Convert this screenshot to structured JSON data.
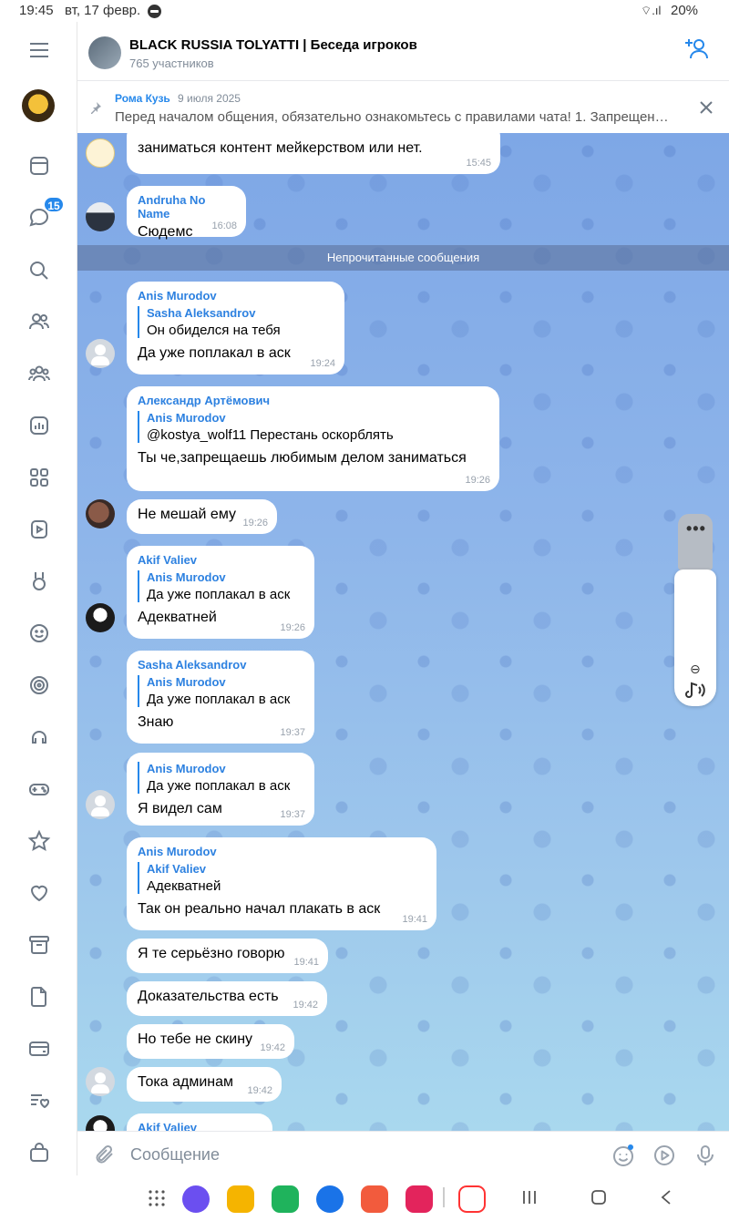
{
  "status": {
    "time": "19:45",
    "date": "вт, 17 февр.",
    "battery": "20%"
  },
  "nav": {
    "badge": "15"
  },
  "header": {
    "title": "BLACK RUSSIA TOLYATTI | Беседа игроков",
    "subtitle": "765 участников"
  },
  "pinned": {
    "author": "Рома Кузь",
    "date": "9 июля 2025",
    "text": "Перед началом общения, обязательно ознакомьтесь с правилами чата!  1. Запрещен…"
  },
  "unread_label": "Непрочитанные сообщения",
  "messages": [
    {
      "author": "",
      "text": "заниматься контент мейкерством или нет.",
      "time": "15:45"
    },
    {
      "author": "Andruha No Name",
      "text": "Сюдемс",
      "time": "16:08"
    },
    {
      "author": "Anis Murodov",
      "reply_author": "Sasha Aleksandrov",
      "reply_text": "Он обиделся на тебя",
      "text": "Да уже поплакал в аск",
      "time": "19:24"
    },
    {
      "author": "Александр Артёмович",
      "reply_author": "Anis Murodov",
      "reply_text": "@kostya_wolf11 Перестань оскорблять",
      "text": "Ты че,запрещаешь любимым делом заниматься",
      "time": "19:26"
    },
    {
      "author": "",
      "text": "Не мешай ему",
      "time": "19:26"
    },
    {
      "author": "Akif Valiev",
      "reply_author": "Anis Murodov",
      "reply_text": "Да уже поплакал в аск",
      "text": "Адекватней",
      "time": "19:26"
    },
    {
      "author": "Sasha Aleksandrov",
      "reply_author": "Anis Murodov",
      "reply_text": "Да уже поплакал в аск",
      "text": "Знаю",
      "time": "19:37"
    },
    {
      "author": "",
      "reply_author": "Anis Murodov",
      "reply_text": "Да уже поплакал в аск",
      "text": "Я видел сам",
      "time": "19:37"
    },
    {
      "author": "Anis Murodov",
      "reply_author": "Akif Valiev",
      "reply_text": "Адекватней",
      "text": "Так он реально начал плакать в аск",
      "time": "19:41"
    },
    {
      "author": "",
      "text": "Я те серьёзно говорю",
      "time": "19:41"
    },
    {
      "author": "",
      "text": "Доказательства есть",
      "time": "19:42"
    },
    {
      "author": "",
      "text": "Но тебе не скину",
      "time": "19:42"
    },
    {
      "author": "",
      "text": "Тока админам",
      "time": "19:42"
    },
    {
      "author": "Akif Valiev",
      "text": "",
      "time": ""
    }
  ],
  "composer": {
    "placeholder": "Сообщение"
  },
  "scroll": {
    "zoom_icon": "⊖"
  }
}
